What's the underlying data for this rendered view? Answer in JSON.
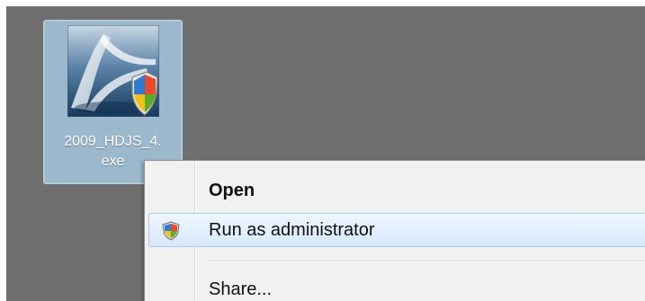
{
  "desktop": {
    "file": {
      "name_line1": "2009_HDJS_4.",
      "name_line2": "exe",
      "icon": "application-icon-with-uac-shield"
    }
  },
  "context_menu": {
    "items": [
      {
        "label": "Open",
        "style": "bold",
        "icon": ""
      },
      {
        "label": "Run as administrator",
        "style": "highlighted",
        "icon": "uac-shield-icon"
      },
      {
        "label": "Share...",
        "style": "normal",
        "icon": ""
      }
    ]
  },
  "colors": {
    "desktop_background": "#6f6f6f",
    "selection_background": "#9cb8cc",
    "menu_background": "#f1f1f1",
    "menu_highlight": "#d8e8fb"
  }
}
